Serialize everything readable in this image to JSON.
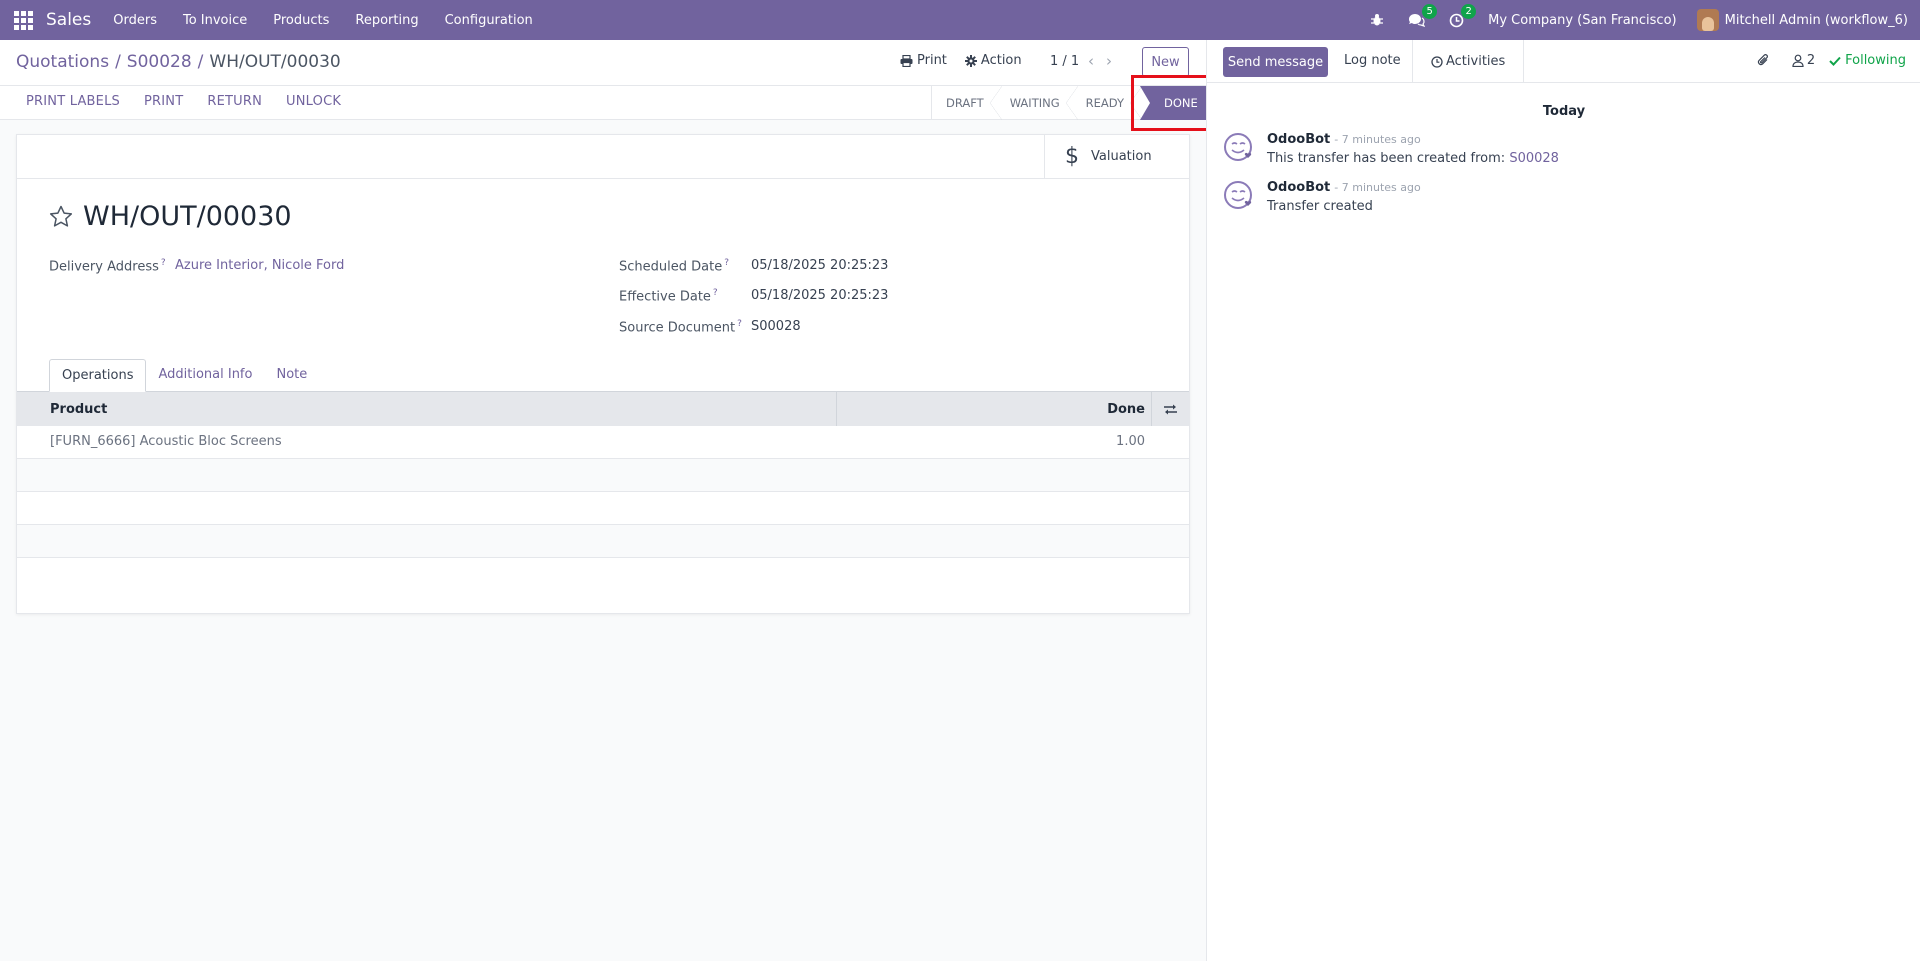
{
  "navbar": {
    "app_name": "Sales",
    "menu": [
      "Orders",
      "To Invoice",
      "Products",
      "Reporting",
      "Configuration"
    ],
    "messages_count": "5",
    "activities_count": "2",
    "company": "My Company (San Francisco)",
    "user": "Mitchell Admin (workflow_6)"
  },
  "breadcrumb": {
    "items": [
      "Quotations",
      "S00028"
    ],
    "current": "WH/OUT/00030",
    "separator": "/"
  },
  "control": {
    "print_label": "Print",
    "action_label": "Action",
    "pager": "1 / 1",
    "new_label": "New"
  },
  "buttons": [
    "PRINT LABELS",
    "PRINT",
    "RETURN",
    "UNLOCK"
  ],
  "statusbar": {
    "stages": [
      "DRAFT",
      "WAITING",
      "READY",
      "DONE"
    ],
    "current": "DONE"
  },
  "smart_buttons": {
    "valuation": "Valuation"
  },
  "record": {
    "title": "WH/OUT/00030",
    "delivery_address_label": "Delivery Address",
    "delivery_address": "Azure Interior, Nicole Ford",
    "scheduled_date_label": "Scheduled Date",
    "scheduled_date": "05/18/2025 20:25:23",
    "effective_date_label": "Effective Date",
    "effective_date": "05/18/2025 20:25:23",
    "source_document_label": "Source Document",
    "source_document": "S00028",
    "help_mark": "?"
  },
  "tabs": [
    "Operations",
    "Additional Info",
    "Note"
  ],
  "operations": {
    "columns": [
      "Product",
      "Done"
    ],
    "rows": [
      {
        "product": "[FURN_6666] Acoustic Bloc Screens",
        "done": "1.00"
      }
    ]
  },
  "chatter": {
    "send_message": "Send message",
    "log_note": "Log note",
    "activities": "Activities",
    "followers_count": "2",
    "following": "Following",
    "day": "Today",
    "messages": [
      {
        "author": "OdooBot",
        "time": "- 7 minutes ago",
        "body": "This transfer has been created from: ",
        "link": "S00028"
      },
      {
        "author": "OdooBot",
        "time": "- 7 minutes ago",
        "body": "Transfer created",
        "link": ""
      }
    ]
  },
  "colors": {
    "brand": "#71639e",
    "success": "#10a44a",
    "highlight": "#e5101a"
  }
}
